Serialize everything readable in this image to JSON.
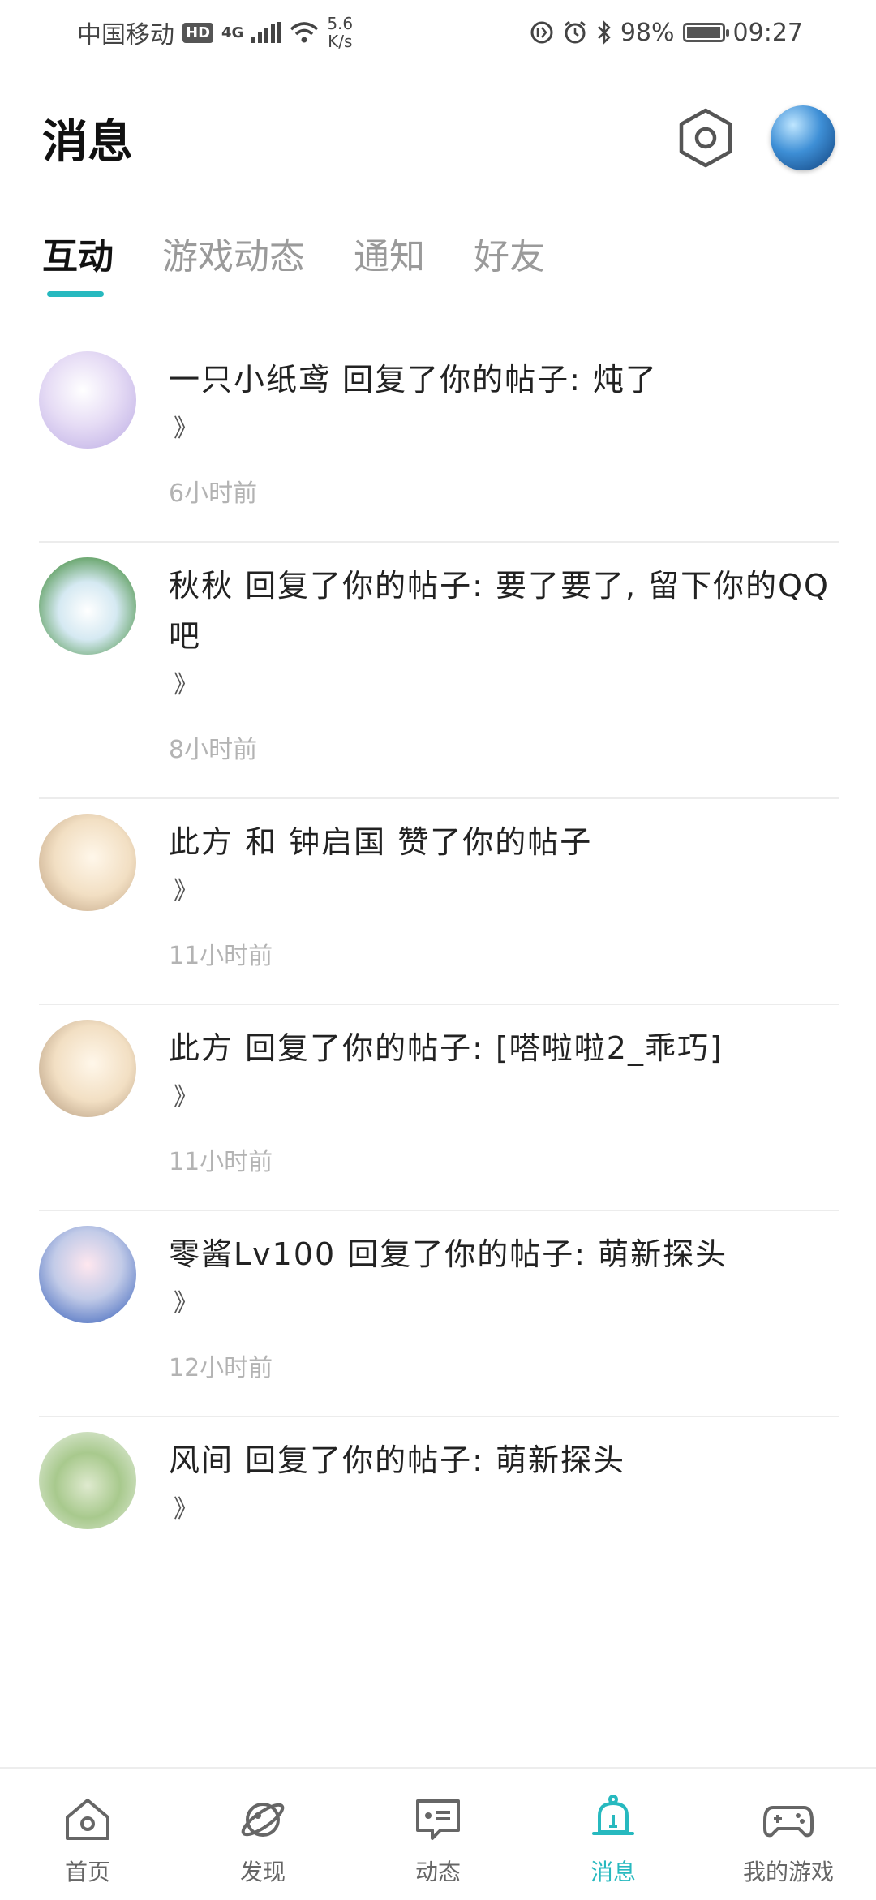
{
  "status_bar": {
    "carrier": "中国移动",
    "hd": "HD",
    "network": "4G",
    "net_speed": "5.6\nK/s",
    "battery": "98%",
    "battery_level": 0.98,
    "time": "09:27"
  },
  "header": {
    "title": "消息"
  },
  "tabs": [
    {
      "label": "互动",
      "active": true
    },
    {
      "label": "游戏动态",
      "active": false
    },
    {
      "label": "通知",
      "active": false
    },
    {
      "label": "好友",
      "active": false
    }
  ],
  "messages": [
    {
      "text": "一只小纸鸢 回复了你的帖子: 炖了",
      "more": "》",
      "time": "6小时前"
    },
    {
      "text": "秋秋 回复了你的帖子: 要了要了, 留下你的QQ吧",
      "more": "》",
      "time": "8小时前"
    },
    {
      "text": "此方 和 钟启国 赞了你的帖子",
      "more": "》",
      "time": "11小时前"
    },
    {
      "text": "此方 回复了你的帖子: [嗒啦啦2_乖巧]",
      "more": "》",
      "time": "11小时前"
    },
    {
      "text": "零酱Lv100 回复了你的帖子: 萌新探头",
      "more": "》",
      "time": "12小时前"
    },
    {
      "text": "风间 回复了你的帖子: 萌新探头",
      "more": "》",
      "time": ""
    }
  ],
  "bottom_nav": [
    {
      "label": "首页",
      "icon": "home-icon",
      "active": false
    },
    {
      "label": "发现",
      "icon": "planet-icon",
      "active": false
    },
    {
      "label": "动态",
      "icon": "chat-card-icon",
      "active": false
    },
    {
      "label": "消息",
      "icon": "bell-icon",
      "active": true
    },
    {
      "label": "我的游戏",
      "icon": "gamepad-icon",
      "active": false
    }
  ],
  "colors": {
    "accent": "#27b9bf",
    "inactive_tab": "#9a9a9a",
    "time_text": "#b3b3b3"
  }
}
